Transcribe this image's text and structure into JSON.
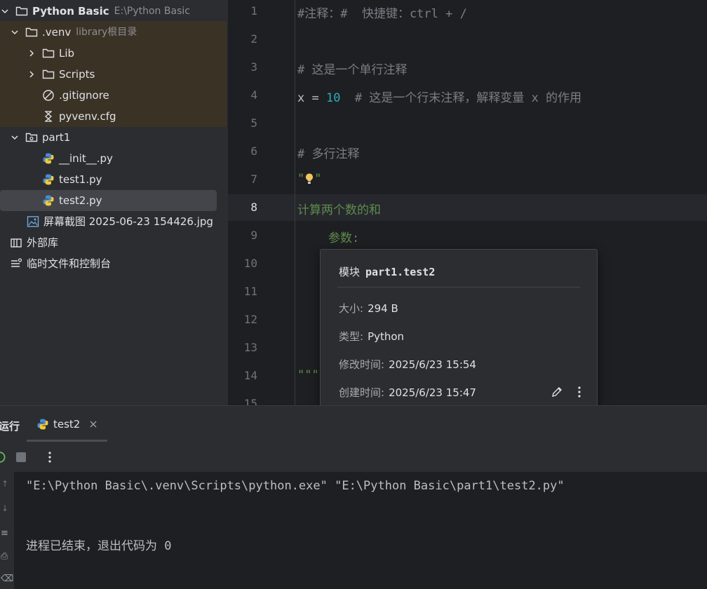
{
  "project": {
    "root": {
      "name": "Python Basic",
      "path": "E:\\Python Basic"
    },
    "items": [
      {
        "label": ".venv",
        "hint": "library根目录"
      },
      {
        "label": "Lib"
      },
      {
        "label": "Scripts"
      },
      {
        "label": ".gitignore"
      },
      {
        "label": "pyvenv.cfg"
      },
      {
        "label": "part1"
      },
      {
        "label": "__init__.py"
      },
      {
        "label": "test1.py"
      },
      {
        "label": "test2.py"
      },
      {
        "label": "屏幕截图 2025-06-23 154426.jpg"
      },
      {
        "label": "外部库"
      },
      {
        "label": "临时文件和控制台"
      }
    ]
  },
  "editor": {
    "line_numbers": [
      "1",
      "2",
      "3",
      "4",
      "5",
      "6",
      "7",
      "8",
      "9",
      "10",
      "11",
      "12",
      "13",
      "14",
      "15"
    ],
    "current_line": 8,
    "lines": {
      "l1": "#注释：#  快捷键：ctrl + /",
      "l3": "# 这是一个单行注释",
      "l4_code": "x = ",
      "l4_num": "10",
      "l4_comment": "  # 这是一个行末注释，解释变量 x 的作用",
      "l6": "# 多行注释",
      "l7": "\"",
      "l7_end": "\"",
      "l8": "计算两个数的和",
      "l9": "参数:",
      "l14": "\"\"\""
    }
  },
  "popup": {
    "title_prefix": "模块",
    "title_module": "part1.test2",
    "size_label": "大小:",
    "size_value": "294 B",
    "type_label": "类型:",
    "type_value": "Python",
    "modified_label": "修改时间:",
    "modified_value": "2025/6/23 15:54",
    "created_label": "创建时间:",
    "created_value": "2025/6/23 15:47"
  },
  "run": {
    "title": "运行",
    "tab_label": "test2",
    "output": {
      "command": "\"E:\\Python Basic\\.venv\\Scripts\\python.exe\" \"E:\\Python Basic\\part1\\test2.py\"",
      "exit": "进程已结束，退出代码为 0"
    }
  }
}
